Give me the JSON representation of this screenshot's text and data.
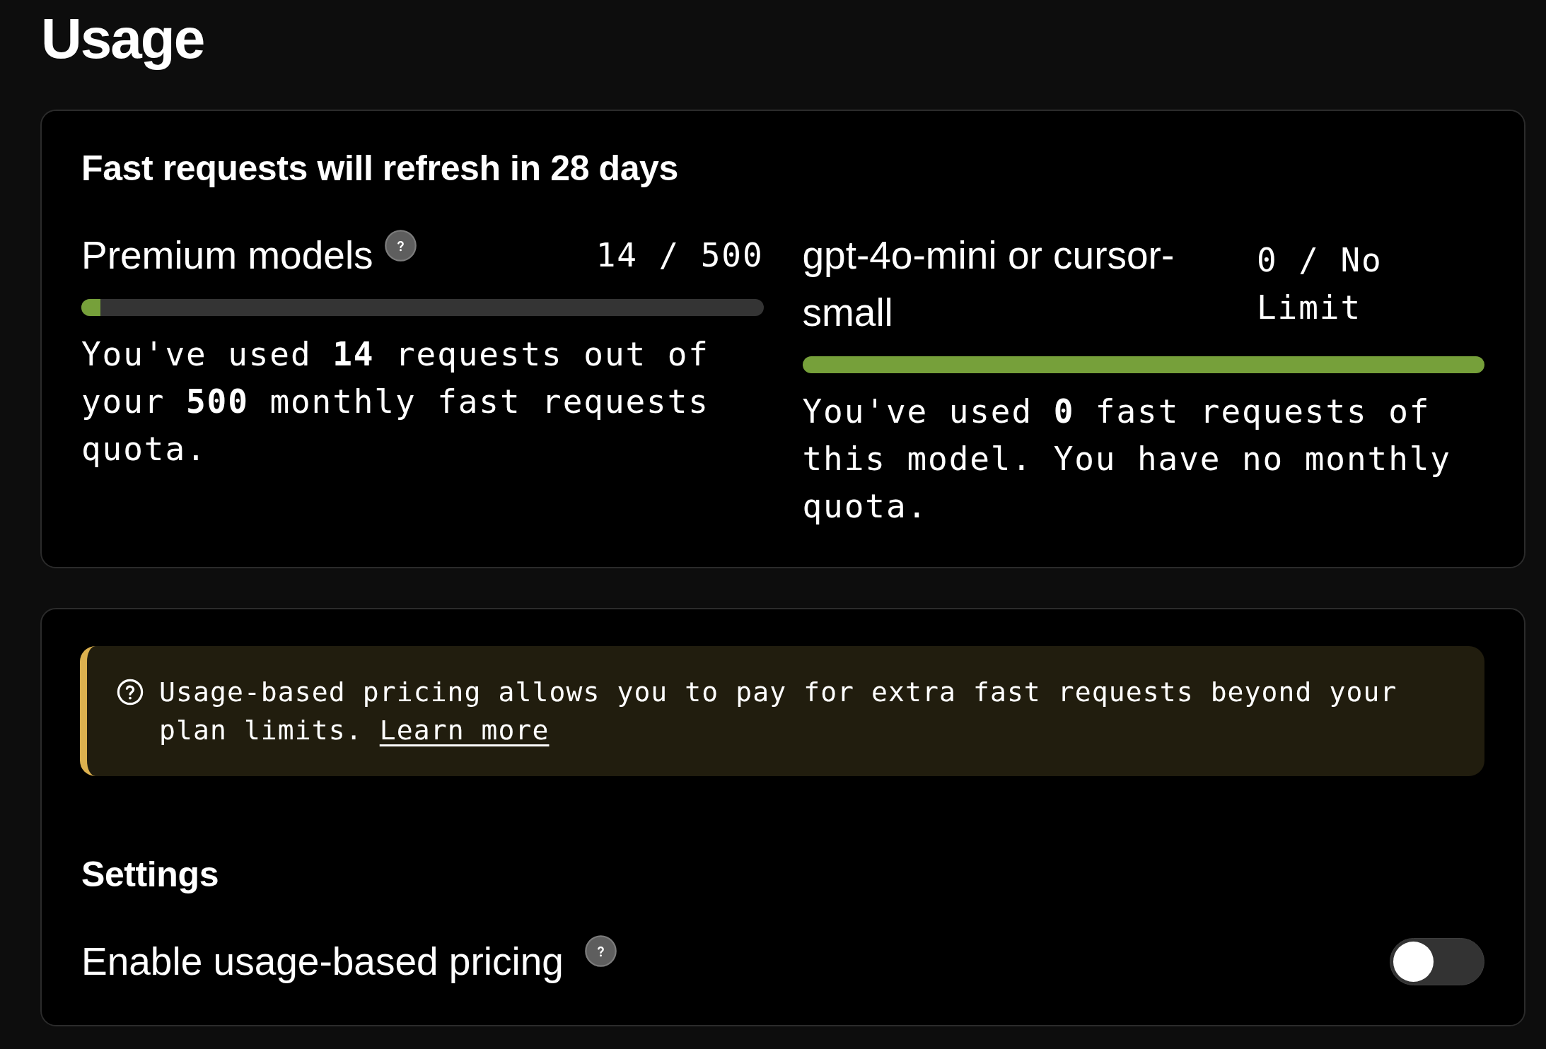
{
  "page": {
    "title": "Usage"
  },
  "quota_card": {
    "title": "Fast requests will refresh in 28 days",
    "meters": [
      {
        "name": "Premium models",
        "help": true,
        "count": "14 / 500",
        "level": 0.028,
        "description": "You've used **14** requests out of your **500** monthly fast requests quota."
      },
      {
        "name": "gpt-4o-mini or cursor-small",
        "help": false,
        "count": "0 / No Limit",
        "level": 1,
        "description": "You've used **0** fast requests of this model. You have no monthly quota."
      }
    ]
  },
  "pricing_card": {
    "notice": {
      "text": "Usage-based pricing allows you to pay for extra fast requests beyond your plan limits.",
      "link": "Learn more"
    },
    "settings": {
      "title": "Settings",
      "items": [
        {
          "label": "Enable usage-based pricing",
          "help": true,
          "on": false
        }
      ]
    }
  }
}
